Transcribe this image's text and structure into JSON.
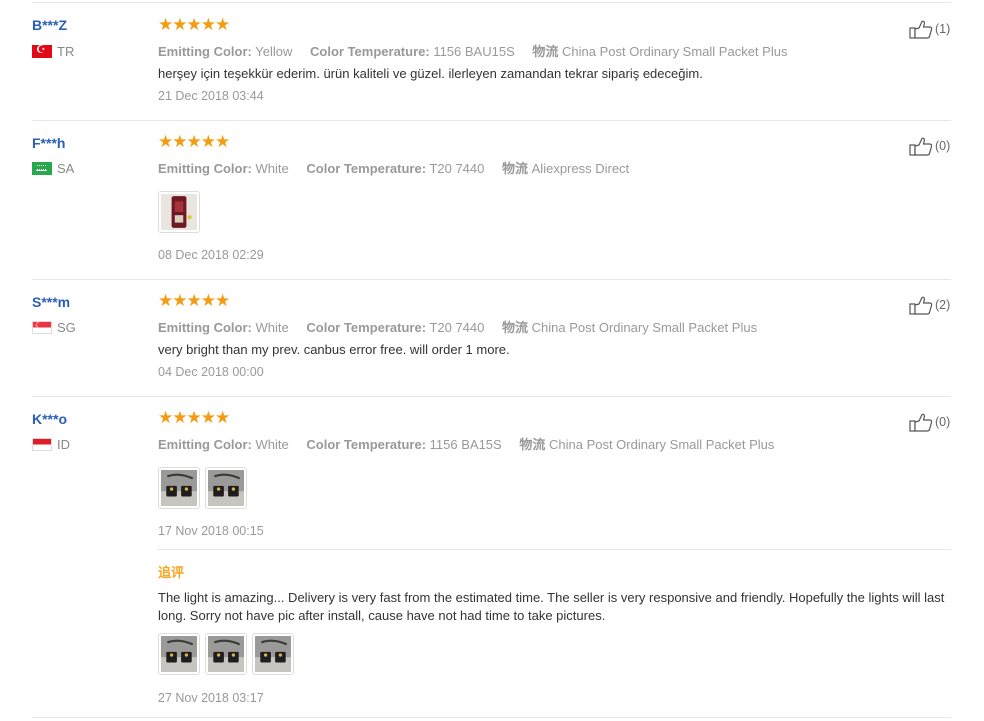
{
  "icons": {
    "rating": "star-icon",
    "helpful": "thumbs-up-icon",
    "photo": "review-photo-thumbnail"
  },
  "colors": {
    "user_name": "#2a5fb8",
    "stars": "#f39c12",
    "additional_title": "#f5a623",
    "meta_text": "#999999"
  },
  "reviews": [
    {
      "user": "B***Z",
      "country": "TR",
      "rating": 5,
      "stars": "★★★★★",
      "props": [
        {
          "key": "Emitting Color:",
          "value": "Yellow"
        },
        {
          "key": "Color Temperature:",
          "value": "1156 BAU15S"
        },
        {
          "key": "物流",
          "value": "China Post Ordinary Small Packet Plus"
        }
      ],
      "feedback": "herşey için teşekkür ederim. ürün kaliteli ve güzel. ilerleyen zamandan tekrar sipariş edeceğim.",
      "date": "21 Dec 2018 03:44",
      "helpful": "(1)"
    },
    {
      "user": "F***h",
      "country": "SA",
      "rating": 5,
      "stars": "★★★★★",
      "props": [
        {
          "key": "Emitting Color:",
          "value": "White"
        },
        {
          "key": "Color Temperature:",
          "value": "T20 7440"
        },
        {
          "key": "物流",
          "value": "Aliexpress Direct"
        }
      ],
      "feedback": "",
      "date": "08 Dec 2018 02:29",
      "helpful": "(0)"
    },
    {
      "user": "S***m",
      "country": "SG",
      "rating": 5,
      "stars": "★★★★★",
      "props": [
        {
          "key": "Emitting Color:",
          "value": "White"
        },
        {
          "key": "Color Temperature:",
          "value": "T20 7440"
        },
        {
          "key": "物流",
          "value": "China Post Ordinary Small Packet Plus"
        }
      ],
      "feedback": "very bright than my prev. canbus error free. will order 1 more.",
      "date": "04 Dec 2018 00:00",
      "helpful": "(2)"
    },
    {
      "user": "K***o",
      "country": "ID",
      "rating": 5,
      "stars": "★★★★★",
      "props": [
        {
          "key": "Emitting Color:",
          "value": "White"
        },
        {
          "key": "Color Temperature:",
          "value": "1156 BA15S"
        },
        {
          "key": "物流",
          "value": "China Post Ordinary Small Packet Plus"
        }
      ],
      "feedback": "",
      "date": "17 Nov 2018 00:15",
      "helpful": "(0)",
      "additional": {
        "title": "追评",
        "feedback": "The light is amazing... Delivery is very fast from the estimated time. The seller is very responsive and friendly. Hopefully the lights will last long. Sorry not have pic after install, cause have not had time to take pictures.",
        "date": "27 Nov 2018 03:17"
      }
    }
  ]
}
